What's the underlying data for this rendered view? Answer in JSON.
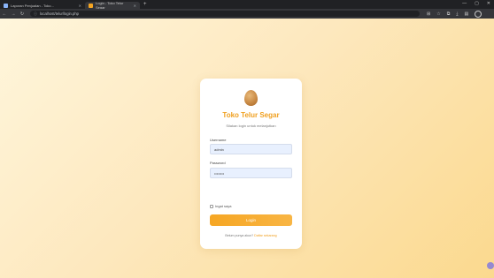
{
  "browser": {
    "tabs": [
      {
        "title": "Laporan Penjualan - Toko...",
        "active": false
      },
      {
        "title": "Login - Toko Telur Segar",
        "active": true
      }
    ],
    "url": "localhost/telur/login.php"
  },
  "login": {
    "title": "Toko Telur Segar",
    "subtitle": "Silakan login untuk melanjutkan",
    "username_label": "Username",
    "username_value": "admin",
    "password_label": "Password",
    "password_value": "••••••••",
    "remember_label": "Ingat saya",
    "login_button": "Login",
    "footer_text": "Belum punya akun?",
    "footer_link": "Daftar sekarang"
  },
  "colors": {
    "accent": "#f6a623",
    "title": "#f0a020",
    "input_bg": "#e8f0fe"
  }
}
